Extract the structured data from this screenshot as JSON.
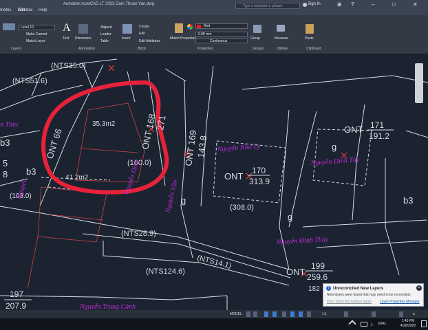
{
  "titlebar": {
    "app_title": "Autodesk AutoCAD LT 2023   Dam Thuan Van.dwg",
    "menus": [
      "metric",
      "Edit",
      "Window",
      "Help"
    ],
    "search_placeholder": "Type a keyword or phrase",
    "signin_label": "Sign In"
  },
  "ribbon": {
    "layer_current": "Level 10",
    "layers_buttons": [
      "Make Current",
      "Match Layer"
    ],
    "annotation": {
      "text": "Text",
      "dimension": "Dimension",
      "aligned": "Aligned",
      "leader": "Leader",
      "table": "Table"
    },
    "block": {
      "insert": "Insert",
      "create": "Create",
      "edit": "Edit",
      "edit_attributes": "Edit Attributes"
    },
    "match_properties": "Match Properties",
    "color": "Red",
    "lineweight": "0.00 mm",
    "linetype": "Continuous",
    "group": "Group",
    "measure": "Measure",
    "paste": "Paste",
    "panels": [
      "Layers",
      "Annotation",
      "Block",
      "Properties",
      "Groups",
      "Utilities",
      "Clipboard"
    ]
  },
  "drawing": {
    "labels": {
      "nts35": "(NTS35.0)",
      "nts51": "(NTS51.6)",
      "thuc": "n Thúc",
      "b3_left": "b3",
      "ont66": "ONT 66",
      "n5": "5",
      "n8": "8",
      "area353": "35.3m2",
      "area412": "41.2m2",
      "ont168": "ONT 168",
      "v271": "271",
      "v160": "(160.0)",
      "ont169": "ONT 169",
      "v1438": "143.8",
      "nhu_ly": "Nguyễn Như Lý",
      "ont170": "ONT",
      "n170": "170",
      "v3139": "313.9",
      "ont171": "ONT",
      "n171": "171",
      "v1912": "191.2",
      "tuy": "Nguyễn Đình Tùy",
      "b3_right": "b3",
      "b3_mid": "b3",
      "v1030": "(103.0)",
      "g_mid": "g",
      "g_right": "g",
      "g_ont171": "g",
      "g_low": "g",
      "v3080": "(308.0)",
      "nts289": "(NTS28.9)",
      "thuy": "Nguyễn Đình Thủy",
      "nts141": "(NTS14.1)",
      "nts1246": "(NTS124.6)",
      "ont199": "ONT",
      "n199": "199",
      "v2596": "259.6",
      "v197": "197",
      "v2079": "207.9",
      "n182": "182",
      "trang_canh": "Nguyễn Trung Cảnh",
      "magenta_left": "Nguyễn",
      "magenta_mid": "Nguyễn Văn",
      "magenta_mid2": "Nguyễn Đình"
    }
  },
  "statusbar": {
    "model": "MODEL",
    "scale": "1:1"
  },
  "toast": {
    "title": "Unreconciled New Layers",
    "body": "New layers were found that may need to be reconciled.",
    "link_left": "Don't show this balloon again",
    "link_right": "Layer Properties Manager"
  },
  "taskbar": {
    "lang": "ENG",
    "time": "1:45 PM",
    "date": "4/28/2020"
  },
  "colors": {
    "background": "#1b2331",
    "linework": "#d9dde3",
    "red_markup": "#e8213b",
    "magenta_text": "#c02ad6"
  }
}
